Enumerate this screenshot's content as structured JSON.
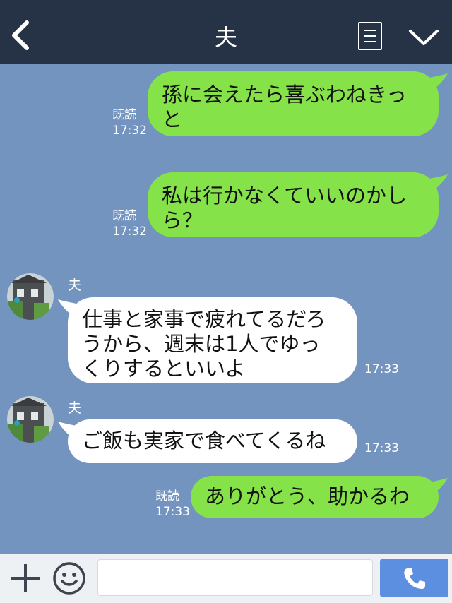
{
  "header": {
    "title": "夫",
    "back_icon": "chevron-left-icon",
    "notes_icon": "notes-icon",
    "menu_icon": "chevron-down-icon"
  },
  "colors": {
    "header_bg": "#263246",
    "chat_bg": "#7494c0",
    "my_bubble": "#85e249",
    "their_bubble": "#ffffff",
    "send_button": "#5d8fe0"
  },
  "messages": [
    {
      "from": "me",
      "text_line1": "孫に会えたら喜ぶわねきっ",
      "text_line2": "と",
      "read": "既読",
      "time": "17:32"
    },
    {
      "from": "me",
      "text_line1": "私は行かなくていいのかし",
      "text_line2": "ら？",
      "read": "既読",
      "time": "17:32"
    },
    {
      "from": "them",
      "sender": "夫",
      "text_line1": "仕事と家事で疲れてるだろ",
      "text_line2": "うから、週末は1人でゆっ",
      "text_line3": "くりするといいよ",
      "time": "17:33"
    },
    {
      "from": "them",
      "sender": "夫",
      "text_line1": "ご飯も実家で食べてくるね",
      "time": "17:33"
    },
    {
      "from": "me",
      "text_line1": "ありがとう、助かるわ",
      "read": "既読",
      "time": "17:33"
    }
  ],
  "composer": {
    "input_value": "",
    "plus_icon": "plus-icon",
    "emoji_icon": "smiley-icon",
    "send_icon": "phone-icon"
  }
}
